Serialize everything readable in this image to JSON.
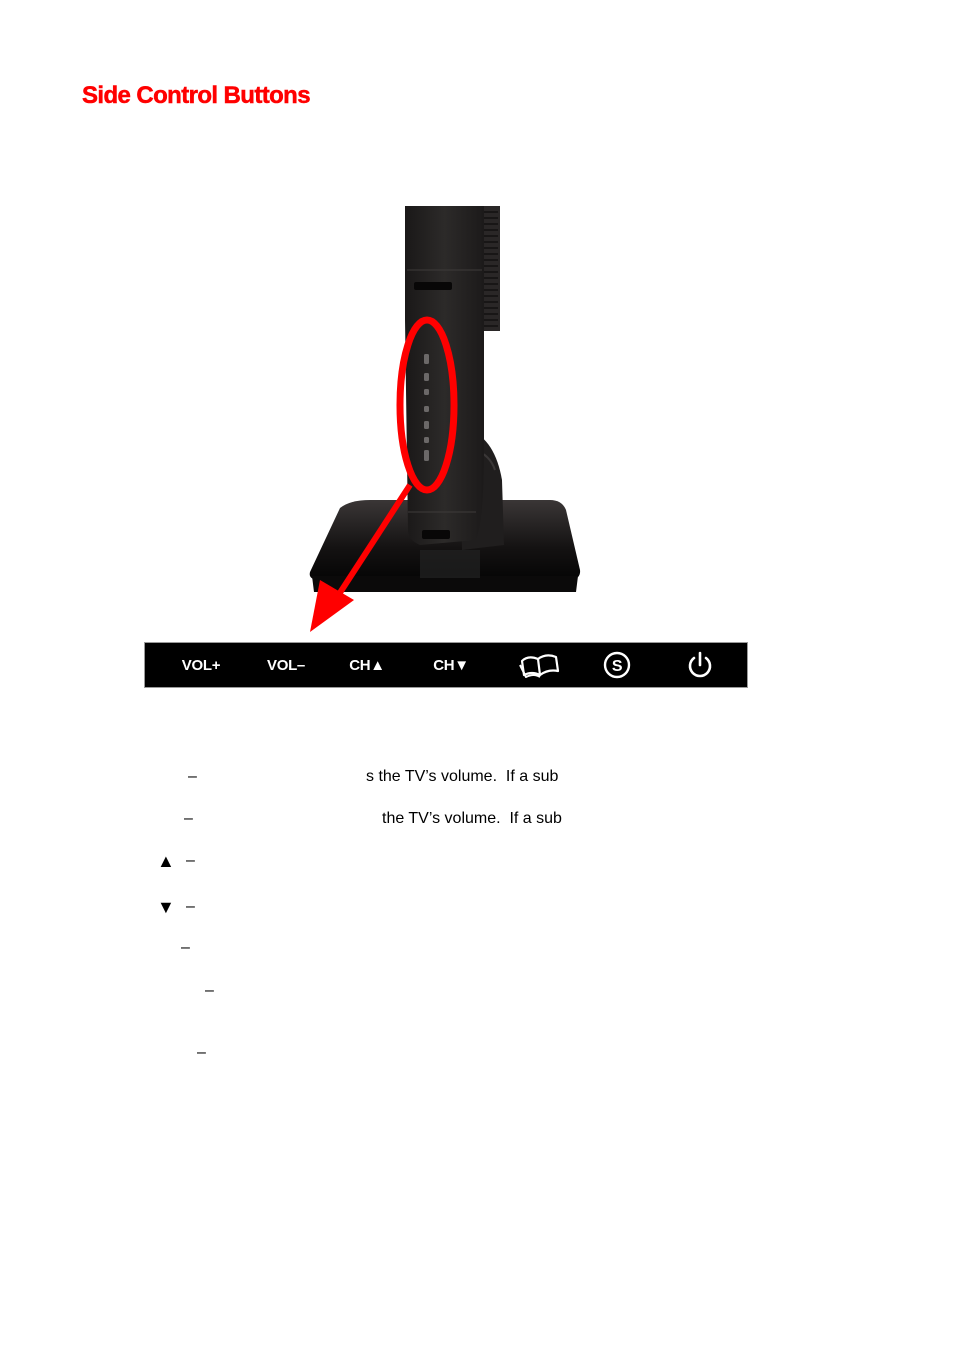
{
  "section": {
    "title": "Side Control Buttons"
  },
  "figure": {
    "description": "Side view of TV on stand with side button panel circled in red and arrow pointing to button legend",
    "highlight_color": "#ff0000",
    "button_count_on_panel": 7
  },
  "button_strip": {
    "background": "#000000",
    "foreground": "#ffffff",
    "buttons": [
      {
        "id": "vol-plus",
        "label": "VOL+",
        "icon": null
      },
      {
        "id": "vol-minus",
        "label": "VOL–",
        "icon": null
      },
      {
        "id": "ch-up",
        "label": "CH▲",
        "icon": null
      },
      {
        "id": "ch-down",
        "label": "CH▼",
        "icon": null
      },
      {
        "id": "menu",
        "label": "",
        "icon": "open-book-icon"
      },
      {
        "id": "source",
        "label": "",
        "icon": "source-s-circle-icon"
      },
      {
        "id": "power",
        "label": "",
        "icon": "power-icon"
      }
    ]
  },
  "descriptions": [
    {
      "marker": "",
      "dash": "–",
      "text": "s the TV’s volume.  If a sub"
    },
    {
      "marker": "",
      "dash": "–",
      "text": "the TV’s volume.  If a sub"
    },
    {
      "marker": "▲",
      "dash": "–",
      "text": ""
    },
    {
      "marker": "▼",
      "dash": "–",
      "text": ""
    },
    {
      "marker": "",
      "dash": "–",
      "text": ""
    },
    {
      "marker": "",
      "dash": "–",
      "text": ""
    },
    {
      "marker": "",
      "dash": "–",
      "text": ""
    }
  ]
}
